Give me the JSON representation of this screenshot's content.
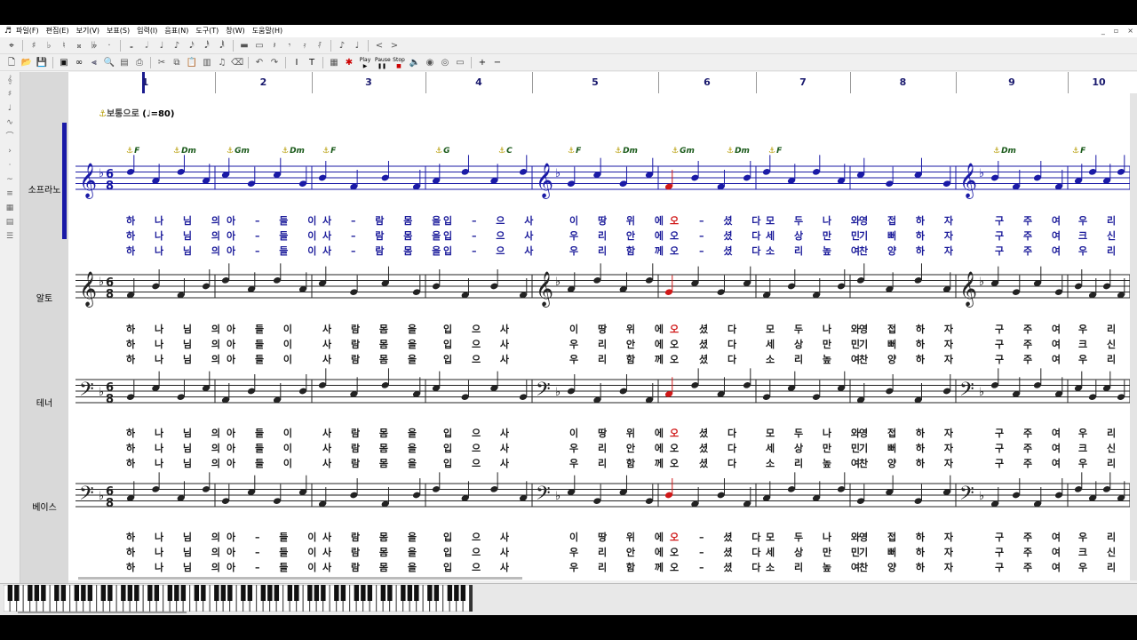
{
  "menubar": {
    "items": [
      "파일(F)",
      "편집(E)",
      "보기(V)",
      "보표(S)",
      "입력(I)",
      "음표(N)",
      "도구(T)",
      "창(W)",
      "도움말(H)"
    ],
    "window_controls": [
      "_",
      "▫",
      "×"
    ]
  },
  "toolbar": {
    "play_label": "Play",
    "pause_label": "Pause",
    "stop_label": "Stop"
  },
  "ruler": {
    "measures": [
      "1",
      "2",
      "3",
      "4",
      "5",
      "6",
      "7",
      "8",
      "9",
      "10"
    ]
  },
  "score": {
    "tempo_text": "보통으로",
    "tempo_value": "=80)",
    "tempo_open": "(",
    "chords": [
      "F",
      "Dm",
      "Gm",
      "Dm",
      "F",
      "G",
      "C",
      "F",
      "Dm",
      "Gm",
      "Dm",
      "F",
      "Dm",
      "F"
    ],
    "time_signature": "6/8",
    "staves": [
      {
        "name": "소프라노",
        "lyrics": [
          [
            "하 나 님 의",
            "아 – 들 이",
            "사 – 람 몸 을",
            "입 – 으 사",
            "이 땅 위 에",
            "오",
            "– 셨 다",
            "모 두 나 와",
            "영 접 하 자",
            "구 주 여",
            "우 리 를"
          ],
          [
            "하 나 님 의",
            "아 – 들 이",
            "사 – 람 몸 을",
            "입 – 으 사",
            "우 리 안 에",
            "오",
            "– 셨 다",
            "세 상 만 민",
            "기 뻐 하 자",
            "구 주 여",
            "크 신 사"
          ],
          [
            "하 나 님 의",
            "아 – 들 이",
            "사 – 람 몸 을",
            "입 – 으 사",
            "우 리 함 께",
            "오",
            "– 셨 다",
            "소 리 높 여",
            "찬 양 하 자",
            "구 주 여",
            "우 리 며"
          ]
        ]
      },
      {
        "name": "알토",
        "lyrics": [
          [
            "하 나 님 의",
            "아 들 이",
            "사 람 몸 을",
            "입 으 사",
            "이 땅 위 에",
            "오",
            "셨 다",
            "모 두 나 와",
            "영 접 하 자",
            "구 주 여",
            "우 리 를"
          ],
          [
            "하 나 님 의",
            "아 들 이",
            "사 람 몸 을",
            "입 으 사",
            "우 리 안 에",
            "오",
            "셨 다",
            "세 상 만 민",
            "기 뻐 하 자",
            "구 주 여",
            "크 신 사"
          ],
          [
            "하 나 님 의",
            "아 들 이",
            "사 람 몸 을",
            "입 으 사",
            "우 리 함 께",
            "오",
            "셨 다",
            "소 리 높 여",
            "찬 양 하 자",
            "구 주 여",
            "우 리 며"
          ]
        ]
      },
      {
        "name": "테너",
        "lyrics": [
          [
            "하 나 님 의",
            "아 들 이",
            "사 람 몸 을",
            "입 으 사",
            "이 땅 위 에",
            "오",
            "셨 다",
            "모 두 나 와",
            "영 접 하 자",
            "구 주 여",
            "우 리 를"
          ],
          [
            "하 나 님 의",
            "아 들 이",
            "사 람 몸 을",
            "입 으 사",
            "우 리 안 에",
            "오",
            "셨 다",
            "세 상 만 민",
            "기 뻐 하 자",
            "구 주 여",
            "크 신 사"
          ],
          [
            "하 나 님 의",
            "아 들 이",
            "사 람 몸 을",
            "입 으 사",
            "우 리 함 께",
            "오",
            "셨 다",
            "소 리 높 여",
            "찬 양 하 자",
            "구 주 여",
            "우 리 며"
          ]
        ]
      },
      {
        "name": "베이스",
        "lyrics": [
          [
            "하 나 님 의",
            "아 – 들 이",
            "사 람 몸 을",
            "입 으 사",
            "이 땅 위 에",
            "오",
            "– 셨 다",
            "모 두 나 와",
            "영 접 하 자",
            "구 주 여",
            "우 리 를"
          ],
          [
            "하 나 님 의",
            "아 – 들 이",
            "사 람 몸 을",
            "입 으 사",
            "우 리 안 에",
            "오",
            "– 셨 다",
            "세 상 만 민",
            "기 뻐 하 자",
            "구 주 여",
            "크 신 사"
          ],
          [
            "하 나 님 의",
            "아 – 들 이",
            "사 람 몸 을",
            "입 으 사",
            "우 리 함 께",
            "오",
            "– 셨 다",
            "소 리 높 여",
            "찬 양 하 자",
            "구 주 여",
            "우 리 며"
          ]
        ]
      }
    ]
  },
  "colors": {
    "selected_staff": "#1a1aa6",
    "highlight_note": "#d01818",
    "measure_number": "#1a1a6e",
    "chord_symbol": "#1a5a1a"
  }
}
